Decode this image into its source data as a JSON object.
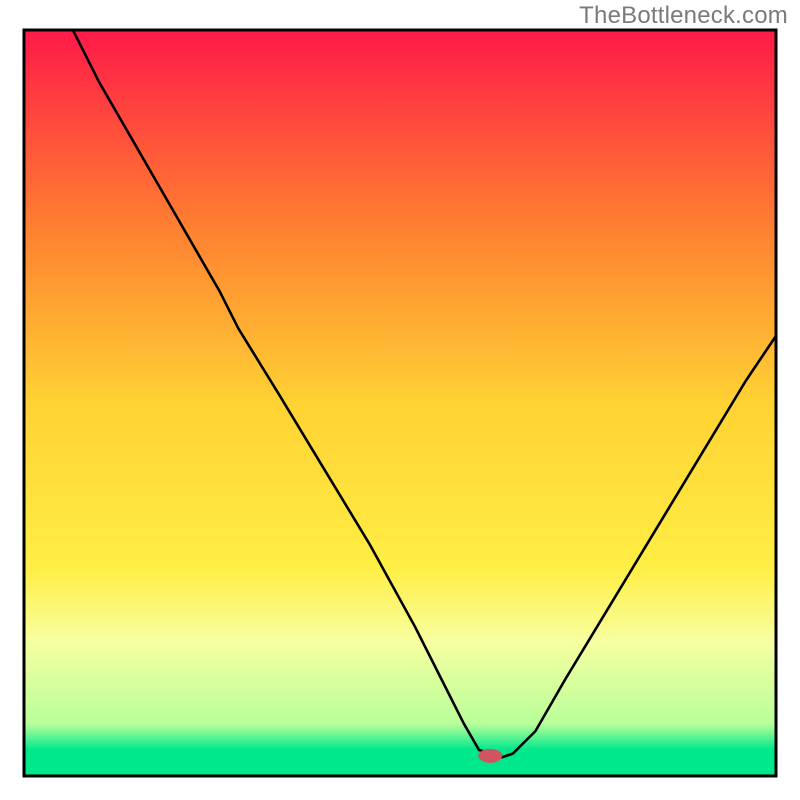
{
  "watermark": "TheBottleneck.com",
  "chart_data": {
    "type": "line",
    "title": "",
    "xlabel": "",
    "ylabel": "",
    "xlim": [
      0,
      100
    ],
    "ylim": [
      0,
      100
    ],
    "grid": false,
    "legend": null,
    "background_gradient": {
      "stops": [
        {
          "pos": 0.0,
          "color": "#ff1a48"
        },
        {
          "pos": 0.25,
          "color": "#ff7a32"
        },
        {
          "pos": 0.5,
          "color": "#ffd233"
        },
        {
          "pos": 0.72,
          "color": "#ffee44"
        },
        {
          "pos": 0.82,
          "color": "#f7ffa0"
        },
        {
          "pos": 0.93,
          "color": "#b8ff9a"
        },
        {
          "pos": 0.965,
          "color": "#00e88c"
        },
        {
          "pos": 1.0,
          "color": "#00e88c"
        }
      ]
    },
    "series": [
      {
        "name": "bottleneck-curve",
        "x": [
          6.5,
          10,
          14,
          18,
          22,
          26,
          28.5,
          34,
          40,
          46,
          52,
          56,
          58.5,
          60.5,
          63.5,
          65,
          68,
          72,
          78,
          84,
          90,
          96,
          100
        ],
        "y": [
          100,
          93,
          86,
          79,
          72,
          65,
          60,
          51,
          41,
          31,
          20,
          12,
          7,
          3.5,
          2.5,
          3,
          6,
          13,
          23,
          33,
          43,
          53,
          59
        ]
      }
    ],
    "marker": {
      "name": "optimal-marker",
      "x": 62,
      "y": 2.7,
      "color": "#d0555f",
      "rx": 12,
      "ry": 7
    },
    "frame": {
      "stroke": "#000000",
      "width": 3
    }
  }
}
